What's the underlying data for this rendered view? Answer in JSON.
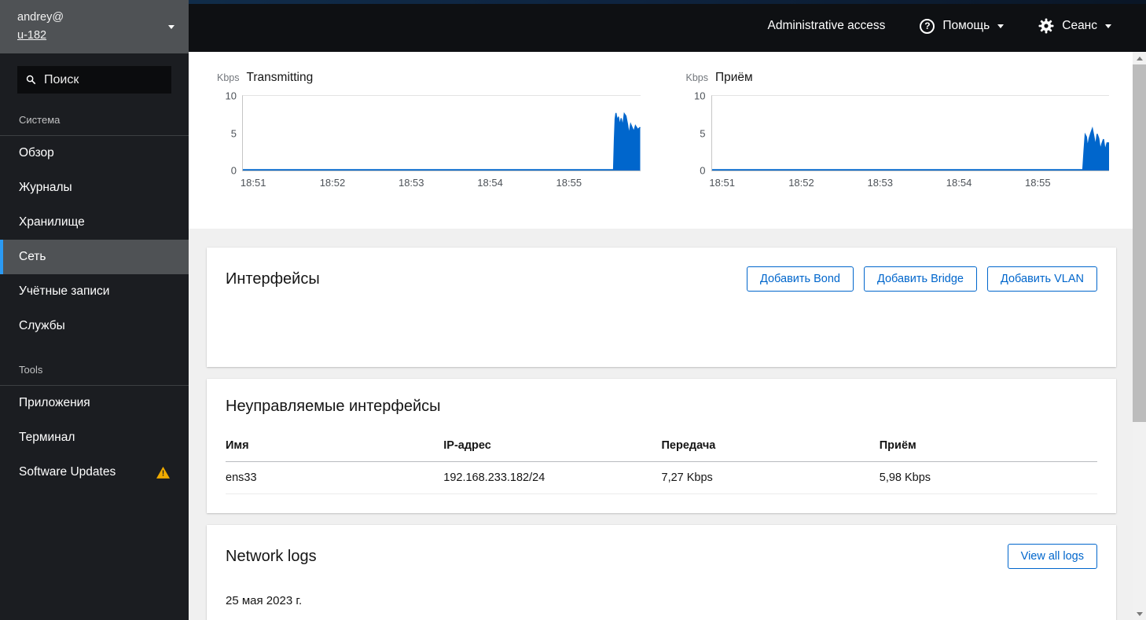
{
  "colors": {
    "accent": "#0066cc",
    "warning": "#f0ab00",
    "nav_active_indicator": "#2b9af3",
    "chart_fill": "#0066cc"
  },
  "masthead": {
    "admin_access": "Administrative access",
    "help": "Помощь",
    "session": "Сеанс"
  },
  "sidebar": {
    "user_line1": "andrey@",
    "user_line2": "u-182",
    "search_placeholder": "Поиск",
    "sections": [
      {
        "title": "Система",
        "active_item": "Сеть",
        "items": [
          "Обзор",
          "Журналы",
          "Хранилище",
          "Сеть",
          "Учётные записи",
          "Службы"
        ]
      },
      {
        "title": "Tools",
        "items": [
          "Приложения",
          "Терминал",
          "Software Updates"
        ]
      }
    ]
  },
  "chart_data": [
    {
      "type": "area",
      "title": "Transmitting",
      "unit": "Kbps",
      "color": "#0066cc",
      "ylim": [
        0,
        10
      ],
      "yticks": [
        0,
        5,
        10
      ],
      "grid": false,
      "xtick_labels": [
        "18:51",
        "18:52",
        "18:53",
        "18:54",
        "18:55"
      ],
      "xtick_pos_pct": [
        2.8,
        22.7,
        42.5,
        62.3,
        82.1
      ],
      "points": [
        [
          0,
          0.1
        ],
        [
          93.3,
          0.1
        ],
        [
          93.5,
          4.0
        ],
        [
          93.7,
          6.9
        ],
        [
          93.9,
          7.7
        ],
        [
          94.2,
          6.6
        ],
        [
          94.5,
          7.2
        ],
        [
          94.9,
          6.0
        ],
        [
          95.2,
          7.0
        ],
        [
          95.6,
          5.9
        ],
        [
          96.0,
          7.6
        ],
        [
          96.4,
          7.3
        ],
        [
          96.8,
          6.2
        ],
        [
          97.2,
          4.8
        ],
        [
          97.6,
          6.2
        ],
        [
          98.0,
          5.7
        ],
        [
          98.4,
          5.2
        ],
        [
          98.8,
          6.0
        ],
        [
          99.4,
          5.5
        ],
        [
          100,
          5.8
        ]
      ]
    },
    {
      "type": "area",
      "title": "Приём",
      "unit": "Kbps",
      "color": "#0066cc",
      "ylim": [
        0,
        10
      ],
      "yticks": [
        0,
        5,
        10
      ],
      "grid": false,
      "xtick_labels": [
        "18:51",
        "18:52",
        "18:53",
        "18:54",
        "18:55"
      ],
      "xtick_pos_pct": [
        2.8,
        22.7,
        42.5,
        62.3,
        82.1
      ],
      "points": [
        [
          0,
          0.1
        ],
        [
          93.3,
          0.1
        ],
        [
          93.6,
          2.6
        ],
        [
          93.9,
          4.8
        ],
        [
          94.2,
          4.5
        ],
        [
          94.5,
          3.1
        ],
        [
          94.9,
          4.3
        ],
        [
          95.3,
          5.0
        ],
        [
          95.7,
          5.6
        ],
        [
          96.1,
          4.5
        ],
        [
          96.5,
          3.3
        ],
        [
          96.9,
          4.9
        ],
        [
          97.3,
          4.3
        ],
        [
          97.7,
          2.8
        ],
        [
          98.1,
          3.6
        ],
        [
          98.5,
          4.2
        ],
        [
          98.9,
          2.7
        ],
        [
          99.4,
          3.7
        ],
        [
          100,
          3.7
        ]
      ]
    }
  ],
  "interfaces_card": {
    "title": "Интерфейсы",
    "buttons": [
      "Добавить Bond",
      "Добавить Bridge",
      "Добавить VLAN"
    ]
  },
  "unmanaged_card": {
    "title": "Неуправляемые интерфейсы",
    "columns": [
      "Имя",
      "IP-адрес",
      "Передача",
      "Приём"
    ],
    "rows": [
      [
        "ens33",
        "192.168.233.182/24",
        "7,27 Kbps",
        "5,98 Kbps"
      ]
    ]
  },
  "logs_card": {
    "title": "Network logs",
    "view_all_label": "View all logs",
    "date_heading": "25 мая 2023 г."
  }
}
